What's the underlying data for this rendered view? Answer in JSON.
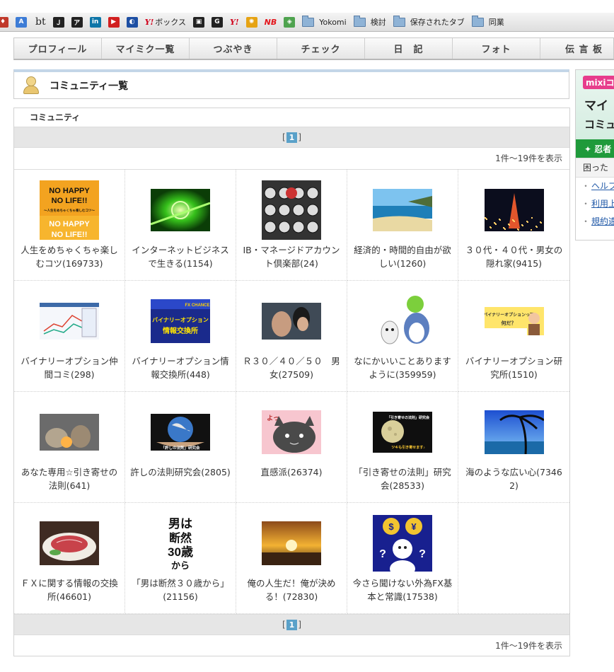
{
  "bookmarks": [
    {
      "type": "icon",
      "label": "",
      "icon": "red-bookmark-icon",
      "color": "#c0392b",
      "glyph": "♦"
    },
    {
      "type": "icon",
      "label": "",
      "icon": "translate-icon",
      "color": "#3d7cd6",
      "glyph": "A"
    },
    {
      "type": "text",
      "label": "bt"
    },
    {
      "type": "icon",
      "label": "",
      "icon": "bookmarklet-icon",
      "color": "#222222",
      "glyph": "Ｊ"
    },
    {
      "type": "icon",
      "label": "",
      "icon": "katakana-a-icon",
      "color": "#222222",
      "glyph": "ア"
    },
    {
      "type": "icon",
      "label": "",
      "icon": "linkedin-icon",
      "color": "#0e76a8",
      "glyph": "in"
    },
    {
      "type": "icon",
      "label": "",
      "icon": "youtube-icon",
      "color": "#d11f1f",
      "glyph": "▶"
    },
    {
      "type": "icon",
      "label": "",
      "icon": "globe-icon",
      "color": "#1d4fa3",
      "glyph": "◐"
    },
    {
      "type": "yahoo",
      "label": "ボックス"
    },
    {
      "type": "icon",
      "label": "",
      "icon": "square-bookmark-icon",
      "color": "#222222",
      "glyph": "▣"
    },
    {
      "type": "icon",
      "label": "",
      "icon": "g-icon",
      "color": "#222222",
      "glyph": "G"
    },
    {
      "type": "yahoo",
      "label": ""
    },
    {
      "type": "icon",
      "label": "",
      "icon": "colorful-globe-icon",
      "color": "#e6a313",
      "glyph": "✺"
    },
    {
      "type": "nb",
      "label": ""
    },
    {
      "type": "icon",
      "label": "",
      "icon": "maps-icon",
      "color": "#4fa34f",
      "glyph": "◈"
    },
    {
      "type": "folder",
      "label": "Yokomi"
    },
    {
      "type": "folder",
      "label": "検討"
    },
    {
      "type": "folder",
      "label": "保存されたタブ"
    },
    {
      "type": "folder",
      "label": "同業"
    }
  ],
  "yahoo_text": "Y!",
  "nb_text": "NB",
  "nav": [
    "プロフィール",
    "マイミク一覧",
    "つぶやき",
    "チェック",
    "日　記",
    "フォト",
    "伝 言 板"
  ],
  "panel": {
    "title": "コミュニティ一覧"
  },
  "community": {
    "heading": "コミュニティ",
    "pager": {
      "open": "[",
      "page": "1",
      "close": "]"
    },
    "count": "1件〜19件を表示",
    "items": [
      {
        "name": "人生をめちゃくちゃ楽しむコツ(169733)",
        "thumb": "no-happy-no-life",
        "t1": "NO HAPPY",
        "t2": "NO LIFE!!",
        "t3": "〜人生をめちゃくちゃ楽しむコツ〜"
      },
      {
        "name": "インターネットビジネスで生きる(1154)",
        "thumb": "green-tech"
      },
      {
        "name": "IB・マネージドアカウント倶楽部(24)",
        "thumb": "typewriter"
      },
      {
        "name": "経済的・時間的自由が欲しい(1260)",
        "thumb": "beach"
      },
      {
        "name": "３０代・４０代・男女の隠れ家(9415)",
        "thumb": "tokyo-tower"
      },
      {
        "name": "バイナリーオプション仲間コミ(298)",
        "thumb": "trading-chart"
      },
      {
        "name": "バイナリーオプション情報交換所(448)",
        "thumb": "binary-banner",
        "t1": "バイナリーオプション",
        "t2": "情報交換所",
        "t3": "FX CHANCE"
      },
      {
        "name": "Ｒ３０／４０／５０　男女(27509)",
        "thumb": "couple-photo"
      },
      {
        "name": "なにかいいことありますように(359959)",
        "thumb": "cartoon-characters"
      },
      {
        "name": "バイナリーオプション研究所(1510)",
        "thumb": "binary-lab",
        "t1": "バイナリーオプションって",
        "t2": "何だ？"
      },
      {
        "name": "あなた専用☆引き寄せの法則(641)",
        "thumb": "cats"
      },
      {
        "name": "許しの法則研究会(2805)",
        "thumb": "earth-hands",
        "t1": "「許しの法則」研究会"
      },
      {
        "name": "直感派(26374)",
        "thumb": "gray-cat-cartoon",
        "t1": "よっ"
      },
      {
        "name": "「引き寄せの法則」研究会(28533)",
        "thumb": "moon-lab",
        "t1": "「引き寄せの法則」研究会",
        "t2": "ツキも引き寄せます♪"
      },
      {
        "name": "海のような広い心(73462)",
        "thumb": "palm-sea"
      },
      {
        "name": "ＦＸに関する情報の交換所(46601)",
        "thumb": "meat-plate"
      },
      {
        "name": "「男は断然３０歳から」(21156)",
        "thumb": "calligraphy",
        "t1": "男は",
        "t2": "断然",
        "t3": "30歳",
        "t4": "から"
      },
      {
        "name": "俺の人生だ！俺が決める！(72830)",
        "thumb": "sunset"
      },
      {
        "name": "今さら聞けない外為FX基本と常識(17538)",
        "thumb": "money-question",
        "t1": "$",
        "t2": "¥",
        "t3": "?"
      }
    ]
  },
  "sidebar": {
    "badge": "mixiコ",
    "line1": "マイ",
    "line2": "コミュ",
    "green": "✦ 忍者",
    "help": "困った",
    "links": [
      "ヘルプ",
      "利用上",
      "規約違"
    ]
  }
}
